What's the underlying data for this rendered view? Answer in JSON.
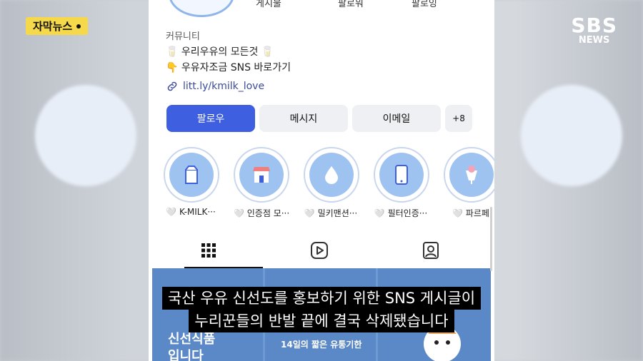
{
  "badge": {
    "label": "자막뉴스"
  },
  "logo": {
    "top": "SBS",
    "bottom": "NEWS"
  },
  "profile": {
    "stats": [
      "게시물",
      "팔로워",
      "팔로잉"
    ],
    "category": "커뮤니티",
    "bio_lines": [
      "🥛 우리우유의 모든것 🥛",
      "👇 우유자조금 SNS 바로가기"
    ],
    "link": "litt.ly/kmilk_love"
  },
  "actions": {
    "follow": "팔로우",
    "message": "메시지",
    "email": "이메일",
    "add_person": "+8"
  },
  "highlights": [
    {
      "label": "🤍 K-MILK···",
      "icon": "milk-carton-icon"
    },
    {
      "label": "🤍 인증점 모···",
      "icon": "store-icon"
    },
    {
      "label": "🤍 밀키맨션···",
      "icon": "drop-icon"
    },
    {
      "label": "🤍 필터인증···",
      "icon": "phone-icon"
    },
    {
      "label": "🤍 파르페",
      "icon": "parfait-icon"
    }
  ],
  "tabs": [
    {
      "name": "grid",
      "icon": "grid-icon"
    },
    {
      "name": "reels",
      "icon": "reels-icon"
    },
    {
      "name": "tagged",
      "icon": "tagged-icon"
    }
  ],
  "posts": {
    "left_text": "신선식품\n입니다",
    "middle_text": "14일의 짧은 유통기한"
  },
  "caption": {
    "line1": "국산 우유 신선도를 홍보하기 위한 SNS 게시글이",
    "line2": "누리꾼들의 반발 끝에 결국 삭제됐습니다"
  },
  "colors": {
    "primary": "#3d5fe0",
    "badge": "#f5d94a",
    "highlight_fill": "#9fc3f0"
  }
}
